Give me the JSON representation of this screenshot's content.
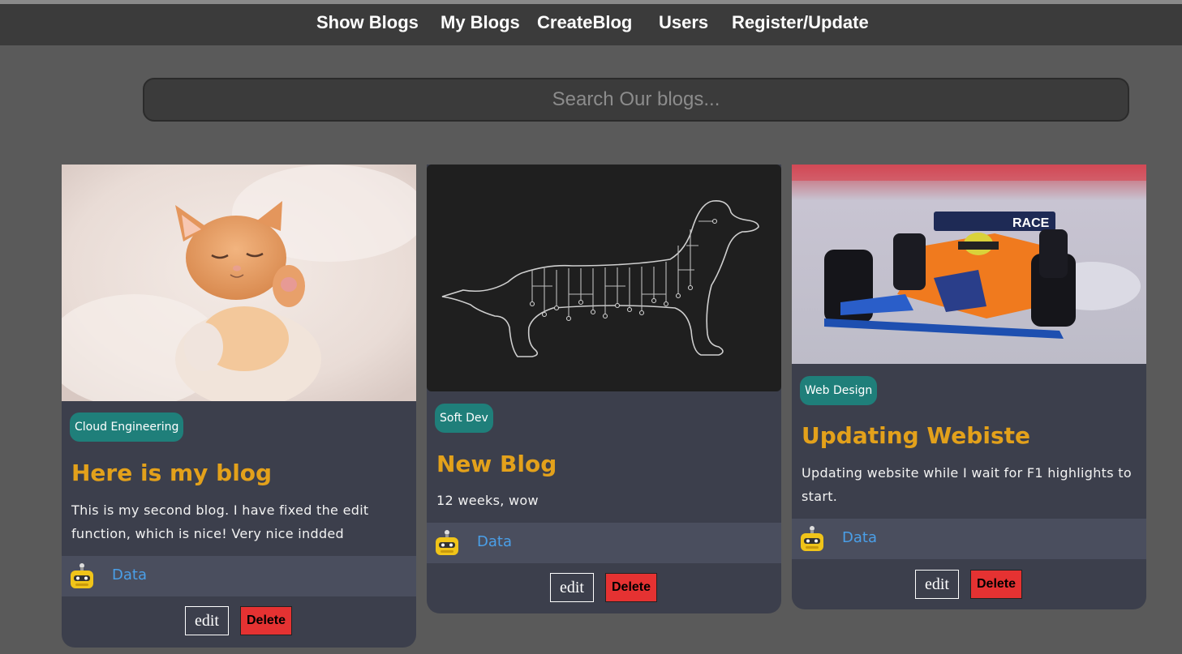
{
  "nav": {
    "show_blogs": "Show Blogs",
    "my_blogs": "My Blogs",
    "create_blog": "CreateBlog",
    "users": "Users",
    "register_update": "Register/Update"
  },
  "search": {
    "placeholder": "Search Our blogs..."
  },
  "posts": [
    {
      "image": "cat-kitten-photo",
      "tag": "Cloud Engineering",
      "title": "Here is my blog",
      "body": "This is my second blog. I have fixed the edit function, which is nice! Very nice indded",
      "author": "Data",
      "edit_label": "edit",
      "delete_label": "Delete"
    },
    {
      "image": "circuit-dachshund-illustration",
      "tag": "Soft Dev",
      "title": "New Blog",
      "body": "12 weeks, wow",
      "author": "Data",
      "edit_label": "edit",
      "delete_label": "Delete"
    },
    {
      "image": "f1-race-car-photo",
      "tag": "Web Design",
      "title": "Updating Webiste",
      "body": "Updating website while I wait for F1 highlights to start.",
      "author": "Data",
      "edit_label": "edit",
      "delete_label": "Delete"
    }
  ],
  "car_livery_text": "RACE",
  "colors": {
    "title": "#e3a11b",
    "tag": "#1f7f7a",
    "author_link": "#4a9fe8",
    "delete": "#e53232",
    "card": "#3c3f4c",
    "page": "#5a5a5a"
  }
}
